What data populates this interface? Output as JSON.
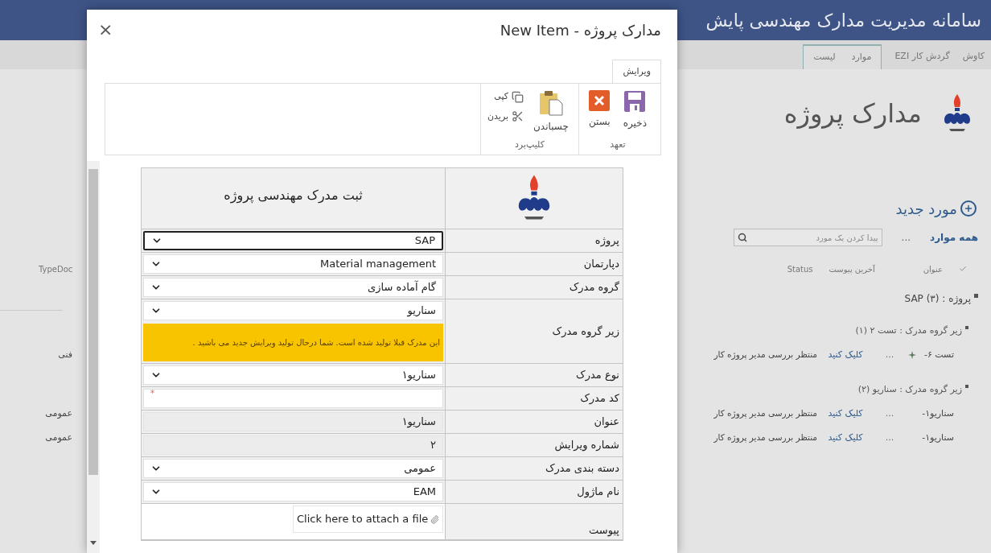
{
  "app_title": "سامانه مدیریت مدارک مهندسی پایش",
  "nav_tabs": [
    {
      "label": "کاوش",
      "contextual": false
    },
    {
      "label": "گردش کار EZI",
      "contextual": false
    },
    {
      "label": "موارد",
      "contextual": true
    },
    {
      "label": "لیست",
      "contextual": true
    }
  ],
  "page": {
    "title": "مدارک پروژه",
    "new_item": "مورد جدید",
    "view": "همه موارد",
    "more": "...",
    "search": {
      "placeholder": "پیدا کردن یک مورد"
    },
    "columns": [
      "عنوان",
      "آخرین پیوست",
      "Status"
    ],
    "left_column": "TypeDoc",
    "group": {
      "label": "پروژه : SAP (۳)",
      "subgroups": [
        {
          "label": "زیر گروه مدرک : تست ۲ (۱)",
          "rows": [
            {
              "title": "تست ۶-",
              "is_new": true,
              "more": "...",
              "link": "کلیک کنید",
              "status": "منتظر بررسی مدیر پروژه کار",
              "type": "فنی"
            }
          ]
        },
        {
          "label": "زیر گروه مدرک : سناریو (۲)",
          "rows": [
            {
              "title": "سناریو۱-",
              "is_new": false,
              "more": "...",
              "link": "کلیک کنید",
              "status": "منتظر بررسی مدیر پروژه کار",
              "type": "عمومی"
            },
            {
              "title": "سناریو۱-",
              "is_new": false,
              "more": "...",
              "link": "کلیک کنید",
              "status": "منتظر بررسی مدیر پروژه کار",
              "type": "عمومی"
            }
          ]
        }
      ]
    }
  },
  "dialog": {
    "title": "مدارک پروژه - New Item",
    "close": "×",
    "ribbon_tabs": [
      {
        "label": "ویرایش",
        "selected": true
      }
    ],
    "ribbon_groups": [
      {
        "label": "تعهد",
        "buttons": [
          {
            "kind": "save",
            "label": "ذخیره"
          },
          {
            "kind": "cancel",
            "label": "بستن"
          }
        ]
      },
      {
        "label": "کلیپ‌برد",
        "buttons": [
          {
            "kind": "paste",
            "label": "چسباندن"
          },
          {
            "kind": "copy",
            "label": "کپی"
          },
          {
            "kind": "cut",
            "label": "بریدن"
          }
        ]
      }
    ],
    "form": {
      "heading": "ثبت مدرک مهندسی پروژه",
      "rows": [
        {
          "label": "پروژه",
          "kind": "select",
          "value": "SAP",
          "focused": true
        },
        {
          "label": "دپارتمان",
          "kind": "select",
          "value": "Material management",
          "focused": false
        },
        {
          "label": "گروه مدرک",
          "kind": "select",
          "value": "گام آماده سازی",
          "focused": false
        },
        {
          "label": "زیر گروه مدرک",
          "kind": "select",
          "value": "سناریو",
          "focused": false,
          "warning": "این مدرک قبلا تولید شده است. شما درحال تولید ویرایش جدید می باشید ."
        },
        {
          "label": "نوع مدرک",
          "kind": "select",
          "value": "سناریو۱",
          "focused": false
        },
        {
          "label": "کد مدرک",
          "kind": "text",
          "required_mark": "*"
        },
        {
          "label": "عنوان",
          "kind": "readonly",
          "value": "سناریو۱"
        },
        {
          "label": "شماره ویرایش",
          "kind": "readonly",
          "value": "۲"
        },
        {
          "label": "دسته بندی مدرک",
          "kind": "select",
          "value": "عمومی",
          "focused": false
        },
        {
          "label": "نام ماژول",
          "kind": "select",
          "value": "EAM",
          "focused": false
        },
        {
          "label": "پیوست",
          "kind": "attachment",
          "value": "Click here to attach a file"
        }
      ]
    }
  }
}
